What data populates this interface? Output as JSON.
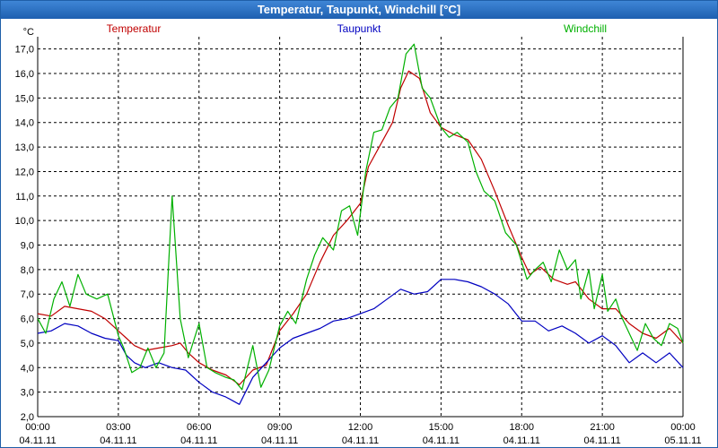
{
  "window": {
    "title": "Temperatur, Taupunkt, Windchill [°C]"
  },
  "chart_data": {
    "type": "line",
    "title": "Temperatur, Taupunkt, Windchill [°C]",
    "ylabel": "°C",
    "ylim": [
      2.0,
      17.5
    ],
    "xlim_hours": [
      0,
      24
    ],
    "grid": true,
    "legend_position": "top",
    "y_ticks": [
      "2,0",
      "3,0",
      "4,0",
      "5,0",
      "6,0",
      "7,0",
      "8,0",
      "9,0",
      "10,0",
      "11,0",
      "12,0",
      "13,0",
      "14,0",
      "15,0",
      "16,0",
      "17,0"
    ],
    "x_ticks": [
      {
        "time": "00:00",
        "date": "04.11.11"
      },
      {
        "time": "03:00",
        "date": "04.11.11"
      },
      {
        "time": "06:00",
        "date": "04.11.11"
      },
      {
        "time": "09:00",
        "date": "04.11.11"
      },
      {
        "time": "12:00",
        "date": "04.11.11"
      },
      {
        "time": "15:00",
        "date": "04.11.11"
      },
      {
        "time": "18:00",
        "date": "04.11.11"
      },
      {
        "time": "21:00",
        "date": "04.11.11"
      },
      {
        "time": "00:00",
        "date": "05.11.11"
      }
    ],
    "series": [
      {
        "name": "Temperatur",
        "color": "#c00000",
        "points": [
          [
            0,
            6.2
          ],
          [
            0.5,
            6.1
          ],
          [
            1,
            6.5
          ],
          [
            1.5,
            6.4
          ],
          [
            2,
            6.3
          ],
          [
            2.5,
            6.0
          ],
          [
            3,
            5.5
          ],
          [
            3.3,
            5.2
          ],
          [
            3.6,
            4.9
          ],
          [
            4,
            4.7
          ],
          [
            4.5,
            4.8
          ],
          [
            5,
            4.9
          ],
          [
            5.3,
            5.0
          ],
          [
            5.6,
            4.6
          ],
          [
            6,
            4.2
          ],
          [
            6.5,
            3.9
          ],
          [
            7,
            3.7
          ],
          [
            7.5,
            3.3
          ],
          [
            8,
            3.9
          ],
          [
            8.5,
            4.1
          ],
          [
            9,
            5.5
          ],
          [
            9.5,
            6.2
          ],
          [
            10,
            7.0
          ],
          [
            10.5,
            8.3
          ],
          [
            11,
            9.4
          ],
          [
            11.5,
            10.0
          ],
          [
            12,
            10.7
          ],
          [
            12.3,
            12.2
          ],
          [
            12.7,
            13.0
          ],
          [
            13.2,
            14.0
          ],
          [
            13.5,
            15.4
          ],
          [
            13.8,
            16.1
          ],
          [
            14.2,
            15.8
          ],
          [
            14.6,
            14.4
          ],
          [
            15,
            13.8
          ],
          [
            15.5,
            13.5
          ],
          [
            16,
            13.3
          ],
          [
            16.5,
            12.5
          ],
          [
            17,
            11.2
          ],
          [
            17.5,
            9.8
          ],
          [
            18,
            8.5
          ],
          [
            18.3,
            7.8
          ],
          [
            18.7,
            8.1
          ],
          [
            19.2,
            7.6
          ],
          [
            19.7,
            7.4
          ],
          [
            20,
            7.5
          ],
          [
            20.5,
            6.8
          ],
          [
            21,
            6.4
          ],
          [
            21.5,
            6.4
          ],
          [
            22,
            5.8
          ],
          [
            22.5,
            5.4
          ],
          [
            23,
            5.2
          ],
          [
            23.5,
            5.6
          ],
          [
            24,
            5.0
          ]
        ]
      },
      {
        "name": "Taupunkt",
        "color": "#0000c0",
        "points": [
          [
            0,
            5.4
          ],
          [
            0.5,
            5.5
          ],
          [
            1,
            5.8
          ],
          [
            1.5,
            5.7
          ],
          [
            2,
            5.4
          ],
          [
            2.5,
            5.2
          ],
          [
            3,
            5.1
          ],
          [
            3.3,
            4.5
          ],
          [
            3.6,
            4.2
          ],
          [
            4,
            4.0
          ],
          [
            4.5,
            4.2
          ],
          [
            5,
            4.0
          ],
          [
            5.5,
            3.9
          ],
          [
            6,
            3.4
          ],
          [
            6.5,
            3.0
          ],
          [
            7,
            2.8
          ],
          [
            7.5,
            2.5
          ],
          [
            8,
            3.6
          ],
          [
            8.5,
            4.2
          ],
          [
            9,
            4.8
          ],
          [
            9.5,
            5.2
          ],
          [
            10,
            5.4
          ],
          [
            10.5,
            5.6
          ],
          [
            11,
            5.9
          ],
          [
            11.5,
            6.0
          ],
          [
            12,
            6.2
          ],
          [
            12.5,
            6.4
          ],
          [
            13,
            6.8
          ],
          [
            13.5,
            7.2
          ],
          [
            14,
            7.0
          ],
          [
            14.5,
            7.1
          ],
          [
            15,
            7.6
          ],
          [
            15.5,
            7.6
          ],
          [
            16,
            7.5
          ],
          [
            16.5,
            7.3
          ],
          [
            17,
            7.0
          ],
          [
            17.5,
            6.6
          ],
          [
            18,
            5.9
          ],
          [
            18.5,
            5.9
          ],
          [
            19,
            5.5
          ],
          [
            19.5,
            5.7
          ],
          [
            20,
            5.4
          ],
          [
            20.5,
            5.0
          ],
          [
            21,
            5.3
          ],
          [
            21.5,
            4.9
          ],
          [
            22,
            4.2
          ],
          [
            22.5,
            4.6
          ],
          [
            23,
            4.2
          ],
          [
            23.5,
            4.6
          ],
          [
            24,
            4.0
          ]
        ]
      },
      {
        "name": "Windchill",
        "color": "#00b000",
        "points": [
          [
            0,
            6.0
          ],
          [
            0.3,
            5.4
          ],
          [
            0.6,
            6.8
          ],
          [
            0.9,
            7.5
          ],
          [
            1.2,
            6.5
          ],
          [
            1.5,
            7.8
          ],
          [
            1.8,
            7.0
          ],
          [
            2.2,
            6.8
          ],
          [
            2.6,
            7.0
          ],
          [
            3,
            5.3
          ],
          [
            3.2,
            4.8
          ],
          [
            3.5,
            3.8
          ],
          [
            3.8,
            4.0
          ],
          [
            4.1,
            4.8
          ],
          [
            4.4,
            4.0
          ],
          [
            4.7,
            4.6
          ],
          [
            5,
            11.0
          ],
          [
            5.3,
            6.0
          ],
          [
            5.6,
            4.4
          ],
          [
            6,
            5.8
          ],
          [
            6.3,
            4.0
          ],
          [
            6.6,
            3.8
          ],
          [
            7,
            3.6
          ],
          [
            7.3,
            3.5
          ],
          [
            7.6,
            3.1
          ],
          [
            8,
            4.9
          ],
          [
            8.3,
            3.2
          ],
          [
            8.6,
            3.9
          ],
          [
            9,
            5.7
          ],
          [
            9.3,
            6.3
          ],
          [
            9.6,
            5.8
          ],
          [
            10,
            7.6
          ],
          [
            10.3,
            8.6
          ],
          [
            10.6,
            9.3
          ],
          [
            11,
            8.8
          ],
          [
            11.3,
            10.4
          ],
          [
            11.6,
            10.6
          ],
          [
            11.9,
            9.4
          ],
          [
            12.2,
            12.0
          ],
          [
            12.5,
            13.6
          ],
          [
            12.8,
            13.7
          ],
          [
            13.1,
            14.6
          ],
          [
            13.4,
            15.0
          ],
          [
            13.7,
            16.8
          ],
          [
            14,
            17.2
          ],
          [
            14.3,
            15.4
          ],
          [
            14.6,
            15.0
          ],
          [
            15,
            13.8
          ],
          [
            15.3,
            13.4
          ],
          [
            15.6,
            13.6
          ],
          [
            16,
            13.2
          ],
          [
            16.3,
            12.0
          ],
          [
            16.6,
            11.2
          ],
          [
            17,
            10.8
          ],
          [
            17.4,
            9.5
          ],
          [
            17.8,
            9.0
          ],
          [
            18.2,
            7.6
          ],
          [
            18.5,
            8.0
          ],
          [
            18.8,
            8.3
          ],
          [
            19.1,
            7.5
          ],
          [
            19.4,
            8.8
          ],
          [
            19.7,
            8.0
          ],
          [
            20,
            8.4
          ],
          [
            20.2,
            6.8
          ],
          [
            20.5,
            8.0
          ],
          [
            20.7,
            6.4
          ],
          [
            21,
            7.8
          ],
          [
            21.2,
            6.3
          ],
          [
            21.5,
            6.8
          ],
          [
            21.7,
            6.1
          ],
          [
            22,
            5.4
          ],
          [
            22.3,
            4.7
          ],
          [
            22.6,
            5.8
          ],
          [
            22.9,
            5.2
          ],
          [
            23.2,
            4.9
          ],
          [
            23.5,
            5.8
          ],
          [
            23.8,
            5.6
          ],
          [
            24,
            5.0
          ]
        ]
      }
    ]
  }
}
